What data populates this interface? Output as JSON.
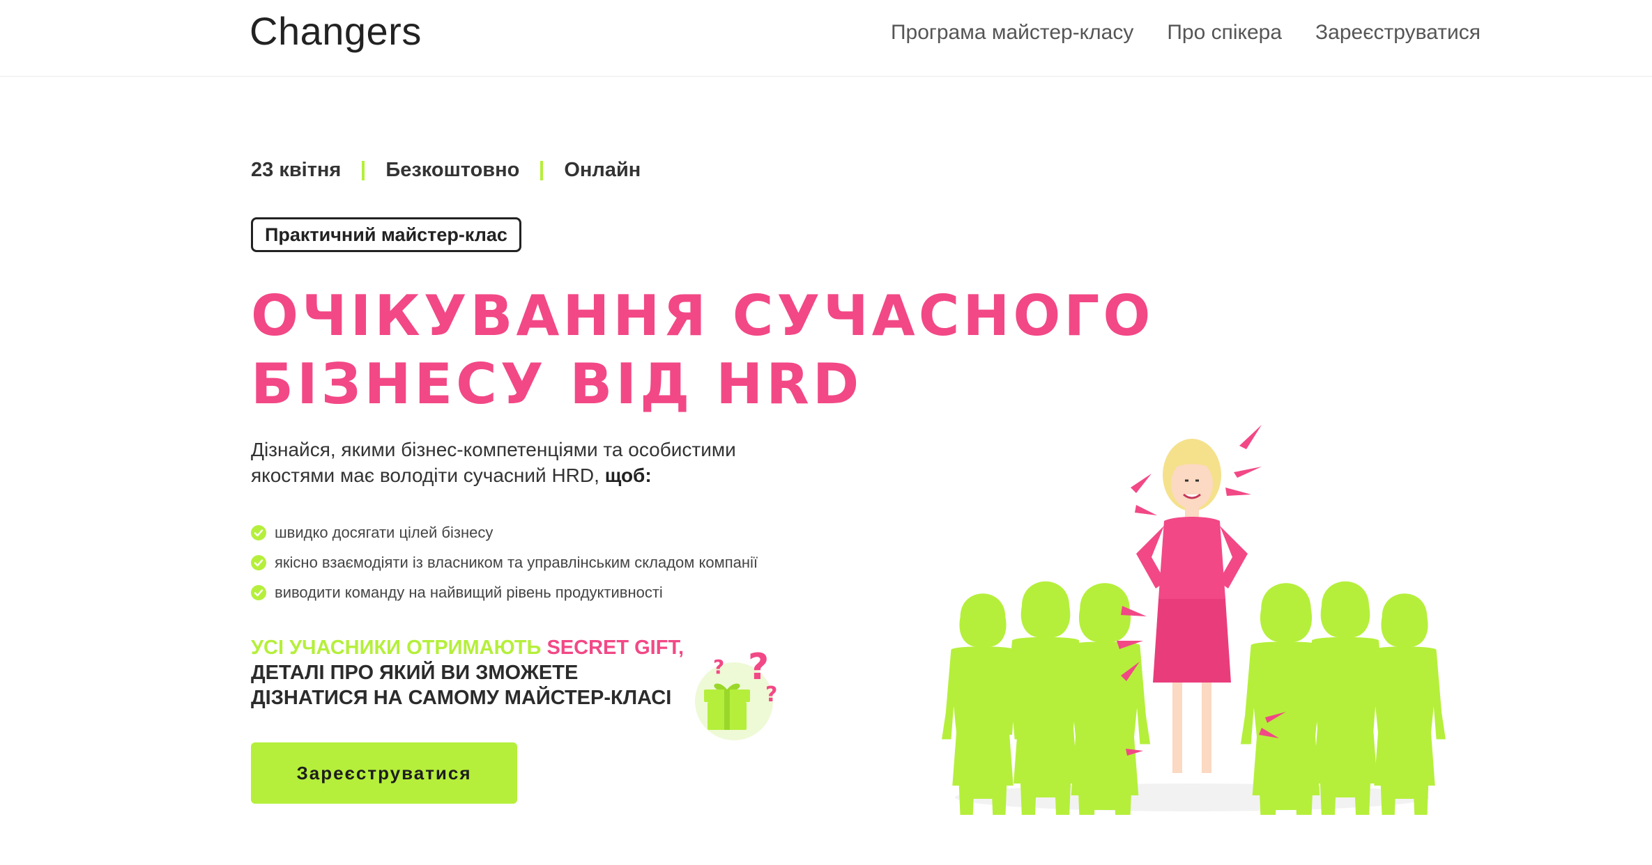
{
  "header": {
    "logo": "Changers",
    "nav": [
      "Програма майстер-класу",
      "Про спікера",
      "Зареєструватися"
    ]
  },
  "hero": {
    "meta": [
      "23 квітня",
      "Безкоштовно",
      "Онлайн"
    ],
    "badge": "Практичний майстер-клас",
    "title_lines": [
      "Очікування сучасного",
      "бізнесу від HRD"
    ],
    "lead": "Дізнайся, якими бізнес-компетенціями та особистими якостями має володіти сучасний HRD,",
    "lead_bold": "щоб:",
    "bullets": [
      "швидко досягати цілей бізнесу",
      "якісно взаємодіяти із власником та управлінським складом компанії",
      "виводити команду на найвищий рівень продуктивності"
    ],
    "gift": {
      "part1": "Усі учасники отримають",
      "part2": "Secret gift,",
      "line2": "деталі про який ви зможете",
      "line3": "дізнатися на самому майстер-класі"
    },
    "cta": "Зареєструватися"
  },
  "colors": {
    "accent_green": "#b5ef3b",
    "accent_pink": "#f24886",
    "text_dark": "#2b2b2b"
  },
  "icons": [
    "check-icon",
    "gift-icon",
    "question-mark-icon"
  ]
}
